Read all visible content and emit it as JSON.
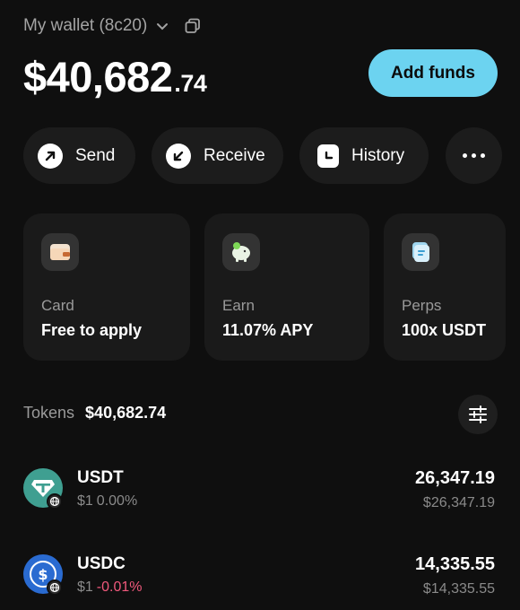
{
  "wallet": {
    "name": "My wallet (8c20)",
    "icons": [
      "chevron-down-icon",
      "copy-icon"
    ]
  },
  "balance": {
    "integer": "$40,682",
    "decimal": ".74"
  },
  "header": {
    "add_funds_label": "Add funds"
  },
  "actions": [
    {
      "label": "Send",
      "icon": "send-arrow-icon"
    },
    {
      "label": "Receive",
      "icon": "receive-arrow-icon"
    },
    {
      "label": "History",
      "icon": "history-clock-icon"
    },
    {
      "label": "",
      "icon": "more-dots-icon"
    }
  ],
  "cards": [
    {
      "title": "Card",
      "subtitle": "Free to apply",
      "icon": "card-icon"
    },
    {
      "title": "Earn",
      "subtitle": "11.07%  APY",
      "icon": "piggy-bank-icon"
    },
    {
      "title": "Perps",
      "subtitle": "100x USDT",
      "icon": "perps-icon"
    }
  ],
  "tokens": {
    "label": "Tokens",
    "total": "$40,682.74",
    "filter_icon": "sliders-icon",
    "items": [
      {
        "symbol": "USDT",
        "price": "$1",
        "change": "0.00%",
        "amount": "26,347.19",
        "usd": "$26,347.19",
        "color": "#3f9f91"
      },
      {
        "symbol": "USDC",
        "price": "$1",
        "change": "-0.01%",
        "amount": "14,335.55",
        "usd": "$14,335.55",
        "color": "#2a6bd1"
      }
    ]
  },
  "colors": {
    "accent": "#6cd3f0",
    "background": "#0f0f0f",
    "negative": "#f0597c"
  }
}
